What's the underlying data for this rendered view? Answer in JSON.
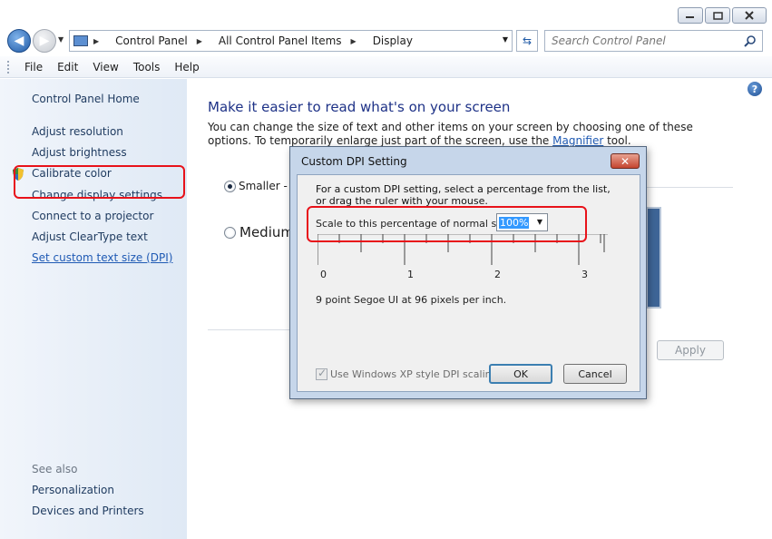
{
  "window": {
    "minimize_icon": "minimize-icon",
    "maximize_icon": "maximize-icon",
    "close_icon": "close-icon"
  },
  "navigation": {
    "breadcrumbs": [
      "Control Panel",
      "All Control Panel Items",
      "Display"
    ],
    "search_placeholder": "Search Control Panel"
  },
  "menu": [
    "File",
    "Edit",
    "View",
    "Tools",
    "Help"
  ],
  "sidebar": {
    "home": "Control Panel Home",
    "items": [
      "Adjust resolution",
      "Adjust brightness",
      "Calibrate color",
      "Change display settings",
      "Connect to a projector",
      "Adjust ClearType text",
      "Set custom text size (DPI)"
    ],
    "see_also_title": "See also",
    "see_also": [
      "Personalization",
      "Devices and Printers"
    ]
  },
  "main": {
    "title": "Make it easier to read what's on your screen",
    "description_part1": "You can change the size of text and other items on your screen by choosing one of these options. To temporarily enlarge just part of the screen, use the ",
    "magnifier_link": "Magnifier",
    "description_part2": " tool.",
    "options": [
      {
        "label": "Smaller - 1",
        "checked": true
      },
      {
        "label": "Medium",
        "checked": false
      }
    ],
    "apply_label": "Apply"
  },
  "dialog": {
    "title": "Custom DPI Setting",
    "intro": "For a custom DPI setting, select a percentage from the list, or drag the ruler with your mouse.",
    "scale_label": "Scale to this percentage of normal size:",
    "scale_value": "100%",
    "ruler_labels": [
      "0",
      "1",
      "2",
      "3"
    ],
    "info": "9 point Segoe UI at 96 pixels per inch.",
    "xp_checkbox": "Use Windows XP style DPI scaling",
    "xp_checked": true,
    "ok_label": "OK",
    "cancel_label": "Cancel"
  },
  "colors": {
    "highlight": "#e8121a",
    "link": "#1f5ab4",
    "title": "#1e3287"
  }
}
